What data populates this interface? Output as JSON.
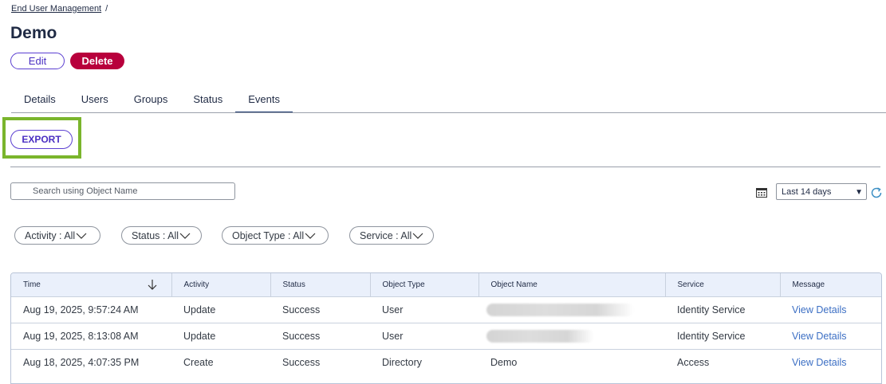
{
  "breadcrumb": {
    "parent": "End User Management",
    "separator": "/"
  },
  "page": {
    "title": "Demo"
  },
  "actions": {
    "edit_label": "Edit",
    "delete_label": "Delete",
    "export_label": "EXPORT"
  },
  "tabs": [
    {
      "label": "Details"
    },
    {
      "label": "Users"
    },
    {
      "label": "Groups"
    },
    {
      "label": "Status"
    },
    {
      "label": "Events",
      "active": true
    }
  ],
  "search": {
    "placeholder": "Search using Object Name",
    "value": ""
  },
  "date_range": {
    "selected": "Last 14 days"
  },
  "filters": [
    {
      "label": "Activity : All"
    },
    {
      "label": "Status : All"
    },
    {
      "label": "Object Type : All"
    },
    {
      "label": "Service : All"
    }
  ],
  "table": {
    "columns": [
      "Time",
      "Activity",
      "Status",
      "Object Type",
      "Object Name",
      "Service",
      "Message"
    ],
    "rows": [
      {
        "time": "Aug 19, 2025, 9:57:24 AM",
        "activity": "Update",
        "status": "Success",
        "object_type": "User",
        "object_name": "",
        "object_name_redacted": true,
        "service": "Identity Service",
        "message": "View Details"
      },
      {
        "time": "Aug 19, 2025, 8:13:08 AM",
        "activity": "Update",
        "status": "Success",
        "object_type": "User",
        "object_name": "",
        "object_name_redacted": true,
        "service": "Identity Service",
        "message": "View Details"
      },
      {
        "time": "Aug 18, 2025, 4:07:35 PM",
        "activity": "Create",
        "status": "Success",
        "object_type": "Directory",
        "object_name": "Demo",
        "object_name_redacted": false,
        "service": "Access",
        "message": "View Details"
      }
    ]
  },
  "colors": {
    "accent": "#5b3fd1",
    "danger": "#b8003c",
    "highlight": "#7ab52c",
    "link": "#3c6fc4",
    "header_bg": "#eaf0fb"
  },
  "icons": {
    "calendar": "calendar-icon",
    "refresh": "refresh-icon",
    "sort": "arrow-down-icon",
    "chevron": "chevron-down-icon"
  }
}
